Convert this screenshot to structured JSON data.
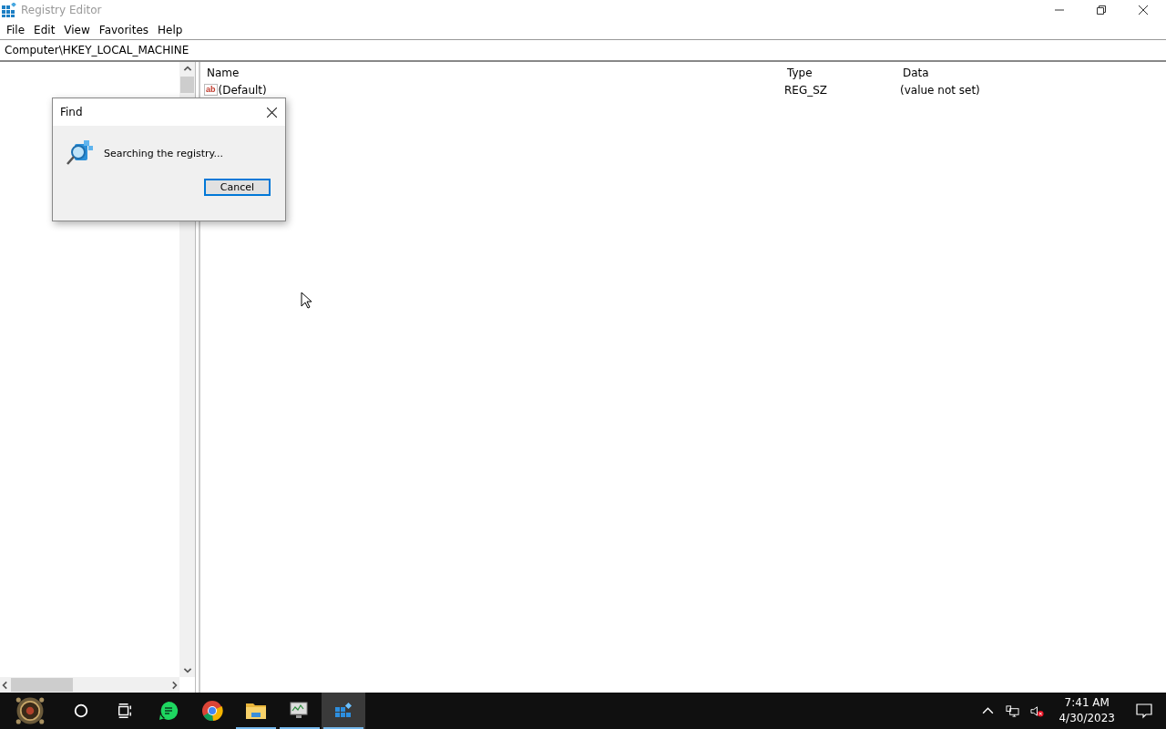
{
  "window": {
    "title": "Registry Editor"
  },
  "menu": [
    "File",
    "Edit",
    "View",
    "Favorites",
    "Help"
  ],
  "address": "Computer\\HKEY_LOCAL_MACHINE",
  "values": {
    "columns": [
      "Name",
      "Type",
      "Data"
    ],
    "rows": [
      {
        "icon_label": "ab",
        "name": "(Default)",
        "type": "REG_SZ",
        "data": "(value not set)",
        "selected": false
      }
    ]
  },
  "find_dialog": {
    "title": "Find",
    "message": "Searching the registry...",
    "button": "Cancel"
  },
  "taskbar": {
    "apps": [
      {
        "running": false,
        "selected": false
      },
      {
        "running": false,
        "selected": false
      },
      {
        "running": true,
        "selected": false
      },
      {
        "running": true,
        "selected": false
      },
      {
        "running": true,
        "selected": true
      }
    ],
    "time": "7:41 AM",
    "date": "4/30/2023"
  }
}
